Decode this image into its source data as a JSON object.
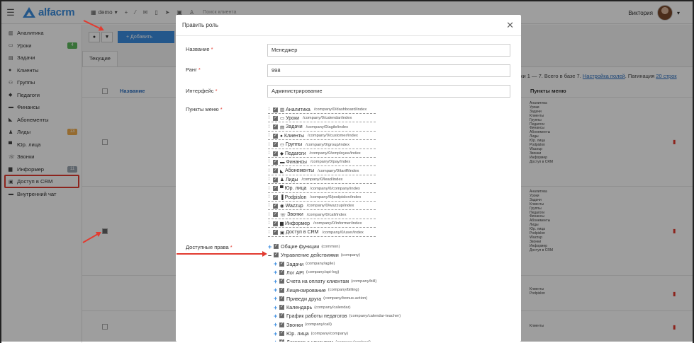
{
  "topbar": {
    "brand": "alfacrm",
    "demo": "demo",
    "search_placeholder": "Поиск клиента",
    "user_name": "Виктория"
  },
  "sidebar": {
    "items": [
      {
        "label": "Аналитика",
        "icon": "chart-icon"
      },
      {
        "label": "Уроки",
        "icon": "calendar-icon",
        "badge": "4",
        "badge_color": "#5cb85c"
      },
      {
        "label": "Задачи",
        "icon": "tasks-icon"
      },
      {
        "label": "Клиенты",
        "icon": "user-icon"
      },
      {
        "label": "Группы",
        "icon": "group-icon"
      },
      {
        "label": "Педагоги",
        "icon": "teacher-icon"
      },
      {
        "label": "Финансы",
        "icon": "money-icon"
      },
      {
        "label": "Абонементы",
        "icon": "tag-icon"
      },
      {
        "label": "Лиды",
        "icon": "lead-icon",
        "badge": "13",
        "badge_color": "#f0ad4e"
      },
      {
        "label": "Юр. лица",
        "icon": "briefcase-icon"
      },
      {
        "label": "Звонки",
        "icon": "phone-icon"
      },
      {
        "label": "Информер",
        "icon": "informer-icon",
        "badge": "11",
        "badge_color": "#9aa5b1"
      },
      {
        "label": "Доступ в CRM",
        "icon": "lock-icon"
      },
      {
        "label": "Внутренний чат",
        "icon": "chat-icon"
      }
    ]
  },
  "main": {
    "add_button": "+ Добавить",
    "tab_current": "Текущие",
    "col_name": "Название",
    "col_menu": "Пункты меню",
    "pager_text": "оки 1 — 7. Всего в базе 7.",
    "pager_fields": "Настройка полей",
    "pager_pagination": ". Пагинация",
    "pager_rows": "20 строк",
    "rows": [
      {
        "menu": [
          "Аналитика",
          "Уроки",
          "Задачи",
          "Клиенты",
          "Группы",
          "Педагоги",
          "Финансы",
          "Абонементы",
          "Лиды",
          "Юр. лица",
          "Podpislon",
          "Wazzup",
          "Звонки",
          "Информер",
          "Доступ в CRM"
        ]
      },
      {
        "menu": [
          "Аналитика",
          "Уроки",
          "Задачи",
          "Клиенты",
          "Группы",
          "Педагоги",
          "Финансы",
          "Абонементы",
          "Лиды",
          "Юр. лица",
          "Podpislon",
          "Wazzup",
          "Звонки",
          "Информер",
          "Доступ в CRM"
        ]
      },
      {
        "menu": [
          "Клиенты",
          "Podpislon"
        ]
      },
      {
        "menu": [
          "Клиенты"
        ]
      }
    ]
  },
  "modal": {
    "title": "Править роль",
    "fields": {
      "name_label": "Название",
      "name_value": "Менеджер",
      "rank_label": "Ранг",
      "rank_value": "998",
      "iface_label": "Интерфейс",
      "iface_value": "Администрирование",
      "menu_label": "Пункты меню",
      "rights_label": "Доступные права",
      "req": "*"
    },
    "menu_items": [
      {
        "label": "Аналитика",
        "path": "/company/0/dashboard/index",
        "icon": "chart-icon"
      },
      {
        "label": "Уроки",
        "path": "/company/0/calendar/index",
        "icon": "calendar-icon"
      },
      {
        "label": "Задачи",
        "path": "/company/0/agile/index",
        "icon": "tasks-icon"
      },
      {
        "label": "Клиенты",
        "path": "/company/0/customer/index",
        "icon": "user-icon"
      },
      {
        "label": "Группы",
        "path": "/company/0/group/index",
        "icon": "group-icon"
      },
      {
        "label": "Педагоги",
        "path": "/company/0/employee/index",
        "icon": "teacher-icon"
      },
      {
        "label": "Финансы",
        "path": "/company/0/pay/index",
        "icon": "money-icon"
      },
      {
        "label": "Абонементы",
        "path": "/company/0/tariff/index",
        "icon": "tag-icon"
      },
      {
        "label": "Лиды",
        "path": "/company/0/lead/index",
        "icon": "lead-icon"
      },
      {
        "label": "Юр. лица",
        "path": "/company/0/company/index",
        "icon": "briefcase-icon"
      },
      {
        "label": "Podpislon",
        "path": "/company/0/podpislon/index",
        "icon": "doc-icon"
      },
      {
        "label": "Wazzup",
        "path": "/company/0/wazzup/index",
        "icon": "whatsapp-icon"
      },
      {
        "label": "Звонки",
        "path": "/company/0/call/index",
        "icon": "phone-icon"
      },
      {
        "label": "Информер",
        "path": "/company/0/informer/index",
        "icon": "informer-icon"
      },
      {
        "label": "Доступ в CRM",
        "path": "/company/0/user/index",
        "icon": "lock-icon"
      }
    ],
    "rights": [
      {
        "label": "Общие функции",
        "sys": "(common)",
        "toggle": "+",
        "level": 0
      },
      {
        "label": "Управление действиями",
        "sys": "(company)",
        "toggle": "–",
        "level": 0
      },
      {
        "label": "Задачи",
        "sys": "(company/agile)",
        "toggle": "+",
        "level": 1
      },
      {
        "label": "Лог API",
        "sys": "(company/api-log)",
        "toggle": "+",
        "level": 1
      },
      {
        "label": "Счета на оплату клиентам",
        "sys": "(company/bill)",
        "toggle": "+",
        "level": 1
      },
      {
        "label": "Лицензирование",
        "sys": "(company/billing)",
        "toggle": "+",
        "level": 1
      },
      {
        "label": "Приведи друга",
        "sys": "(company/bonus-action)",
        "toggle": "+",
        "level": 1
      },
      {
        "label": "Календарь",
        "sys": "(company/calendar)",
        "toggle": "+",
        "level": 1
      },
      {
        "label": "График работы педагогов",
        "sys": "(company/calendar-teacher)",
        "toggle": "+",
        "level": 1
      },
      {
        "label": "Звонки",
        "sys": "(company/call)",
        "toggle": "+",
        "level": 1
      },
      {
        "label": "Юр. лица",
        "sys": "(company/company)",
        "toggle": "+",
        "level": 1
      },
      {
        "label": "Договор с клиентом",
        "sys": "(company/contract)",
        "toggle": "+",
        "level": 1
      }
    ],
    "close_glyph": "✕"
  }
}
